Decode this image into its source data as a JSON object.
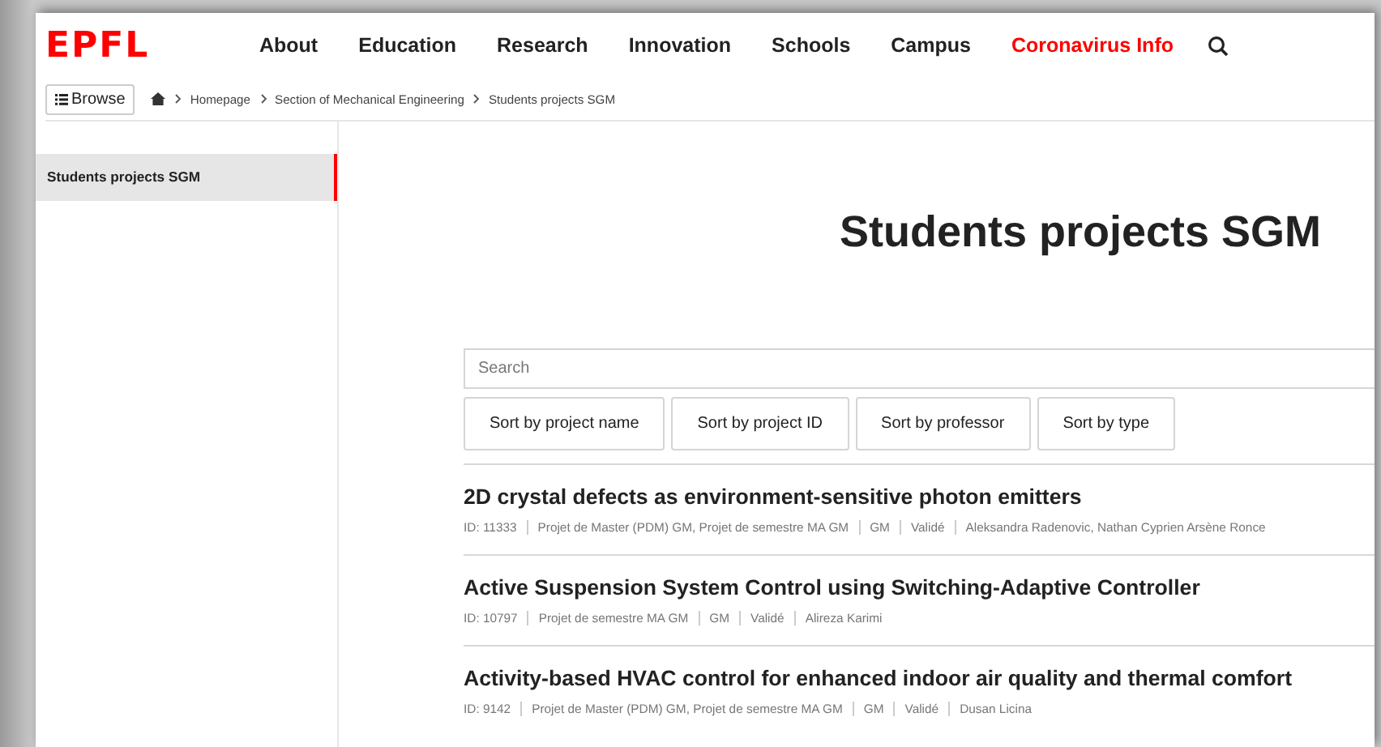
{
  "logo": "EPFL",
  "nav": [
    {
      "label": "About",
      "highlight": false
    },
    {
      "label": "Education",
      "highlight": false
    },
    {
      "label": "Research",
      "highlight": false
    },
    {
      "label": "Innovation",
      "highlight": false
    },
    {
      "label": "Schools",
      "highlight": false
    },
    {
      "label": "Campus",
      "highlight": false
    },
    {
      "label": "Coronavirus Info",
      "highlight": true
    }
  ],
  "browse_button": "Browse",
  "breadcrumb": [
    "Homepage",
    "Section of Mechanical Engineering",
    "Students projects SGM"
  ],
  "sidebar": {
    "items": [
      {
        "label": "Students projects SGM",
        "selected": true
      }
    ]
  },
  "title": "Students projects SGM",
  "search": {
    "placeholder": "Search"
  },
  "sort_buttons": [
    "Sort by project name",
    "Sort by project ID",
    "Sort by professor",
    "Sort by type"
  ],
  "projects": [
    {
      "title": "2D crystal defects as environment-sensitive photon emitters",
      "meta": [
        "ID: 11333",
        "Projet de Master (PDM) GM, Projet de semestre MA GM",
        "GM",
        "Validé",
        "Aleksandra Radenovic, Nathan Cyprien Arsène Ronce"
      ]
    },
    {
      "title": "Active Suspension System Control using Switching-Adaptive Controller",
      "meta": [
        "ID: 10797",
        "Projet de semestre MA GM",
        "GM",
        "Validé",
        "Alireza Karimi"
      ]
    },
    {
      "title": "Activity-based HVAC control for enhanced indoor air quality and thermal comfort",
      "meta": [
        "ID: 9142",
        "Projet de Master (PDM) GM, Projet de semestre MA GM",
        "GM",
        "Validé",
        "Dusan Licina"
      ]
    }
  ]
}
